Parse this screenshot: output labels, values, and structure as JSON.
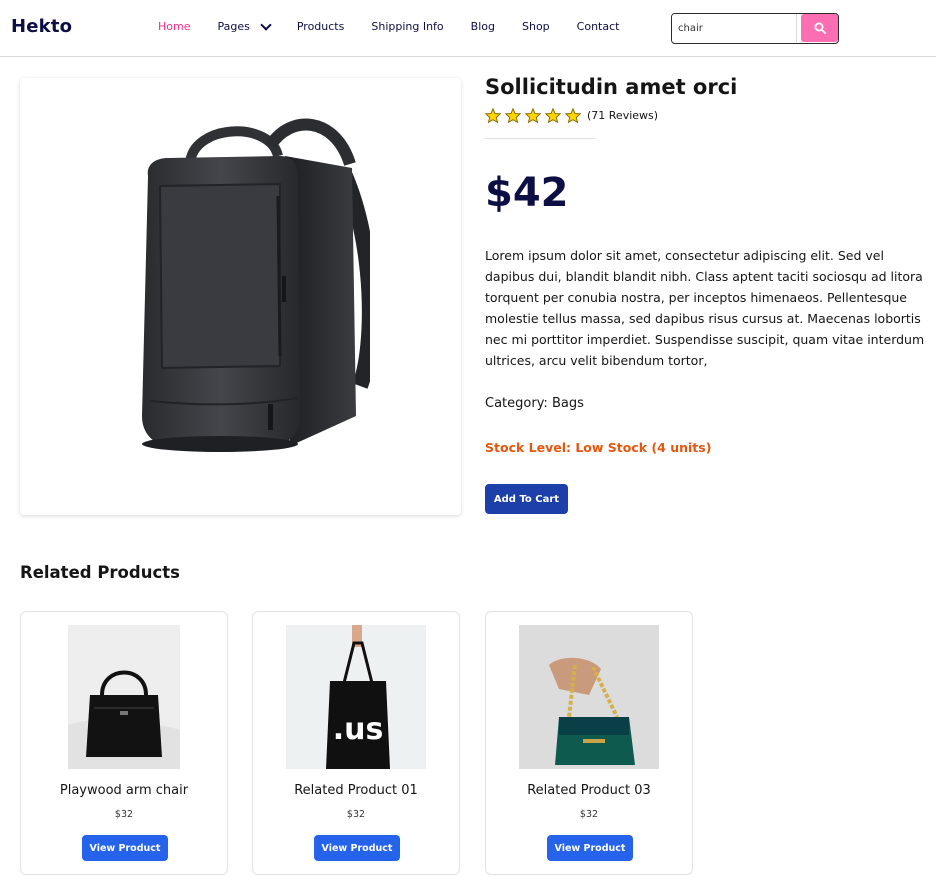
{
  "brand": {
    "logo": "Hekto",
    "accent": "#fb2e86",
    "primary": "#0d0e43"
  },
  "nav": {
    "items": [
      {
        "label": "Home",
        "active": true
      },
      {
        "label": "Pages",
        "active": false,
        "dropdown": true
      },
      {
        "label": "Products",
        "active": false
      },
      {
        "label": "Shipping Info",
        "active": false
      },
      {
        "label": "Blog",
        "active": false
      },
      {
        "label": "Shop",
        "active": false
      },
      {
        "label": "Contact",
        "active": false
      }
    ]
  },
  "search": {
    "value": "chair",
    "icon": "search-icon",
    "button_color": "#fb6fb2"
  },
  "product": {
    "title": "Sollicitudin amet orci",
    "rating": 5,
    "reviews": "(71 Reviews)",
    "price": "$42",
    "description": "Lorem ipsum dolor sit amet, consectetur adipiscing elit. Sed vel dapibus dui, blandit blandit nibh. Class aptent taciti sociosqu ad litora torquent per conubia nostra, per inceptos himenaeos. Pellentesque molestie tellus massa, sed dapibus risus cursus at. Maecenas lobortis nec mi porttitor imperdiet. Suspendisse suscipit, quam vitae interdum ultrices, arcu velit bibendum tortor,",
    "category": "Category: Bags",
    "stock": "Stock Level: Low Stock (4 units)",
    "stock_color": "#e4570f",
    "add_to_cart": "Add To Cart",
    "image": "backpack-image"
  },
  "related": {
    "title": "Related Products",
    "items": [
      {
        "name": "Playwood arm chair",
        "price": "$32",
        "button": "View Product",
        "image": "black-handbag-image"
      },
      {
        "name": "Related Product 01",
        "price": "$32",
        "button": "View Product",
        "image": "tote-bag-image"
      },
      {
        "name": "Related Product 03",
        "price": "$32",
        "button": "View Product",
        "image": "green-purse-image"
      }
    ]
  }
}
